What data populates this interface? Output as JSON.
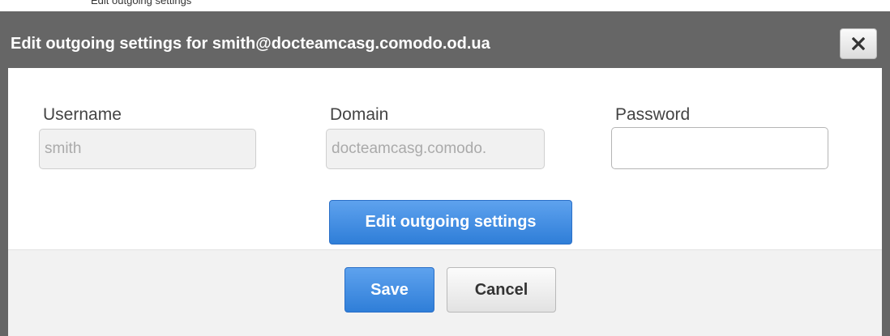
{
  "page_header_partial": "Edit outgoing settings",
  "dialog": {
    "title": "Edit outgoing settings for smith@docteamcasg.comodo.od.ua",
    "close_icon": "close-icon"
  },
  "form": {
    "username": {
      "label": "Username",
      "value": "smith"
    },
    "domain": {
      "label": "Domain",
      "value": "docteamcasg.comodo."
    },
    "password": {
      "label": "Password",
      "value": ""
    },
    "edit_button_label": "Edit outgoing settings"
  },
  "footer": {
    "save_label": "Save",
    "cancel_label": "Cancel"
  },
  "colors": {
    "dialog_background": "#666666",
    "primary_button": "#2f7ed8",
    "footer_background": "#f2f2f2"
  }
}
